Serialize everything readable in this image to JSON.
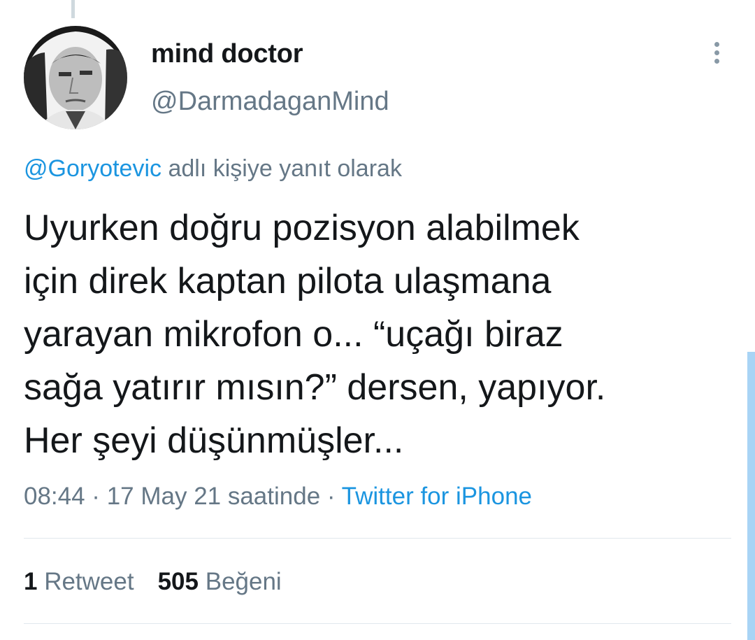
{
  "tweet": {
    "display_name": "mind doctor",
    "handle": "@DarmadaganMind",
    "reply_to": "@Goryotevic",
    "reply_suffix": " adlı kişiye yanıt olarak",
    "text": "Uyurken doğru pozisyon alabilmek\niçin direk kaptan pilota ulaşmana\nyarayan mikrofon o... “uçağı biraz\nsağa yatırır mısın?” dersen, yapıyor.\nHer şeyi düşünmüşler...",
    "timestamp": "08:44 · 17 May 21 saatinde · ",
    "source": "Twitter for iPhone"
  },
  "stats": {
    "retweet_count": "1",
    "retweet_label": " Retweet",
    "like_count": "505",
    "like_label": " Beğeni"
  },
  "icons": {
    "more": "more-vertical-icon"
  },
  "colors": {
    "link": "#1b95e0",
    "muted": "#657786",
    "text": "#14171a",
    "divider": "#e1e8ed"
  }
}
